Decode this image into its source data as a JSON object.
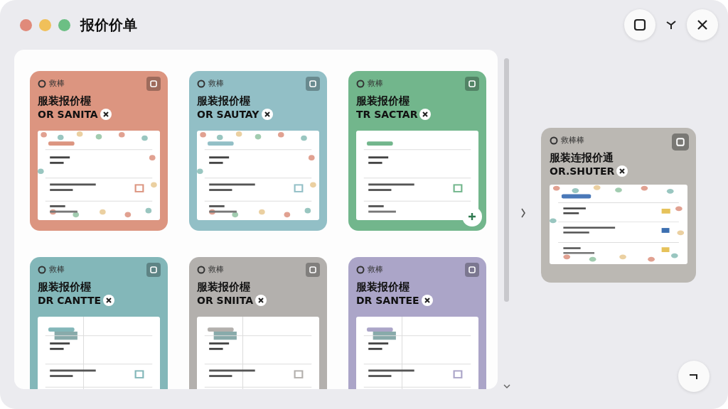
{
  "window": {
    "title": "报价价单"
  },
  "cards": [
    {
      "label": "救棒",
      "title": "服装报价楃",
      "code": "OR SANITA",
      "color": "#dc9580",
      "kind": "dotted",
      "fab": false
    },
    {
      "label": "救棒",
      "title": "服装报价楃",
      "code": "OR SAUTAY",
      "color": "#92bfc6",
      "kind": "dotted",
      "fab": false
    },
    {
      "label": "救棒",
      "title": "服装报价楃",
      "code": "TR SACTAR",
      "color": "#72b68c",
      "kind": "plain",
      "fab": true
    },
    {
      "label": "救棒",
      "title": "服装报价楃",
      "code": "DR CANTTE",
      "color": "#83b7b9",
      "kind": "split",
      "fab": false
    },
    {
      "label": "救棒",
      "title": "服装报价楃",
      "code": "OR SNIITA",
      "color": "#b3b0ad",
      "kind": "split",
      "fab": false
    },
    {
      "label": "救棒",
      "title": "服装报价楃",
      "code": "DR SANTEE",
      "color": "#aba5c8",
      "kind": "split",
      "fab": false
    }
  ],
  "preview": {
    "label": "救棒棒",
    "title": "服装连报价通",
    "code": "OR.SHUTER",
    "color": "#bbb8b3",
    "kind": "dotted"
  }
}
